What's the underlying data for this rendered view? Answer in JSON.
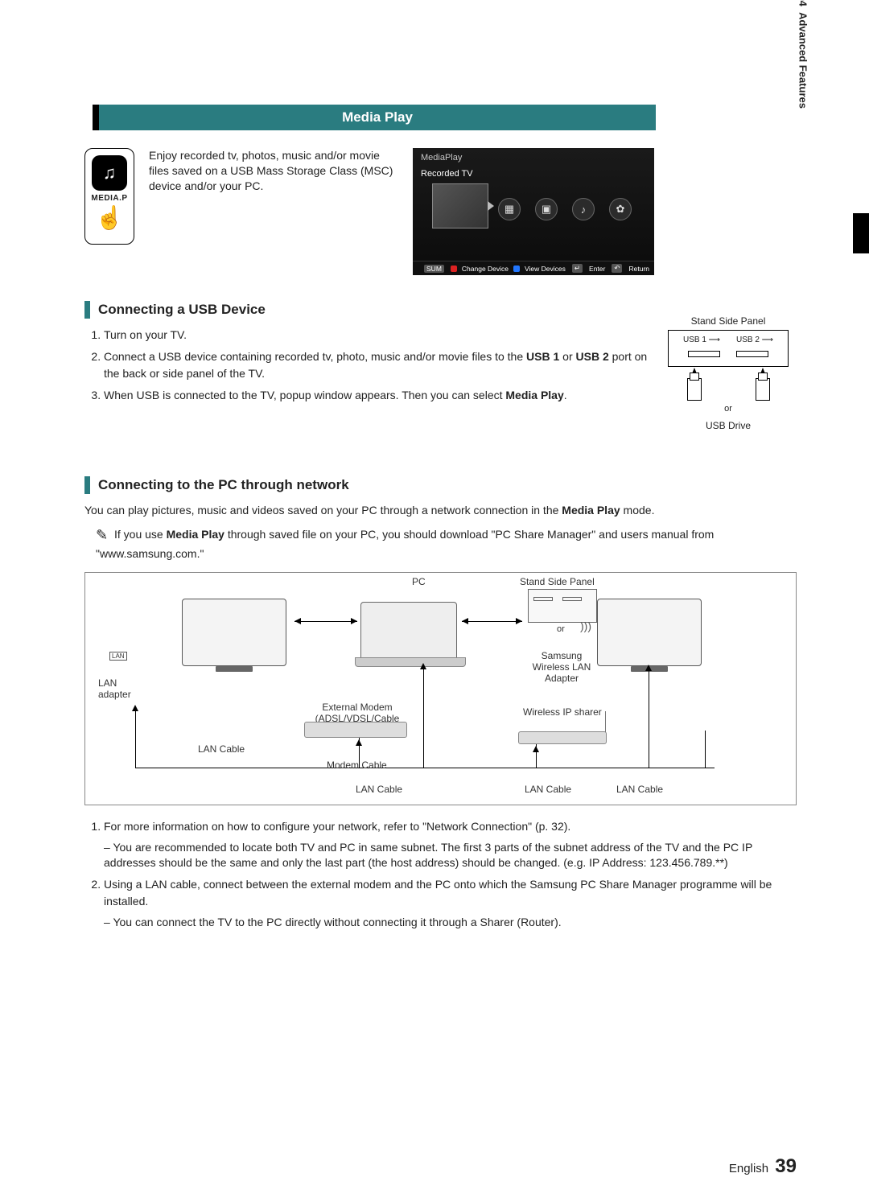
{
  "sideTab": {
    "num": "04",
    "label": "Advanced Features"
  },
  "banner": "Media Play",
  "remote": {
    "label": "MEDIA.P"
  },
  "intro": "Enjoy recorded tv, photos, music and/or movie files saved on a USB Mass Storage Class (MSC) device and/or your PC.",
  "mediaScreen": {
    "title": "MediaPlay",
    "subtitle": "Recorded TV",
    "footer": {
      "sum": "SUM",
      "a": "Change Device",
      "d": "View Devices",
      "enterIcon": "↵",
      "enter": "Enter",
      "returnIcon": "↶",
      "return": "Return"
    }
  },
  "sectionUSB": "Connecting a USB Device",
  "usbPanelLabel": "Stand Side Panel",
  "port1": "USB 1 ⟶",
  "port2": "USB 2 ⟶",
  "orLabel": "or",
  "usbDriveLabel": "USB Drive",
  "steps": [
    "Turn on your TV.",
    "",
    ""
  ],
  "step2a": "Connect a USB device containing recorded tv, photo, music and/or movie files to the ",
  "step2b": "USB 1",
  "step2c": " or ",
  "step2d": "USB 2",
  "step2e": " port on the back or side panel of the TV.",
  "step3a": "When USB is connected to the TV, popup window appears. Then you can select ",
  "step3b": "Media Play",
  "step3c": ".",
  "sectionPC": "Connecting to the PC through network",
  "pcPara1a": "You can play pictures, music and videos saved on your PC through a network connection in the ",
  "pcPara1b": "Media Play",
  "pcPara1c": " mode.",
  "note1a": "If you use ",
  "note1b": "Media Play",
  "note1c": " through saved file on your PC, you should download \"PC Share Manager\" and users manual from \"www.samsung.com.\"",
  "diagram": {
    "pc": "PC",
    "standPanel": "Stand Side Panel",
    "lan": "LAN",
    "lanPort": "LAN",
    "lanAdapter": "LAN adapter",
    "external": "External Modem",
    "externalSub": "(ADSL/VDSL/Cable TV)",
    "wireless": "Wireless IP sharer",
    "samsungAdapter": "Samsung Wireless LAN Adapter",
    "or": "or",
    "lanCable": "LAN Cable",
    "modemCable": "Modem Cable"
  },
  "steps2": {
    "s1": "For more information on how to configure your network, refer to \"Network Connection\" (p. 32).",
    "s1sub": "You are recommended to locate both TV and PC in same subnet. The first 3 parts of the subnet address of the TV and the PC IP addresses should be the same and only the last part (the host address) should be changed. (e.g. IP Address: 123.456.789.**)",
    "s2": "Using a LAN cable, connect between the external modem and the PC onto which the Samsung PC Share Manager programme will be installed.",
    "s2sub": "You can connect the TV to the PC directly without connecting it through a Sharer (Router)."
  },
  "footer": {
    "lang": "English",
    "page": "39"
  }
}
